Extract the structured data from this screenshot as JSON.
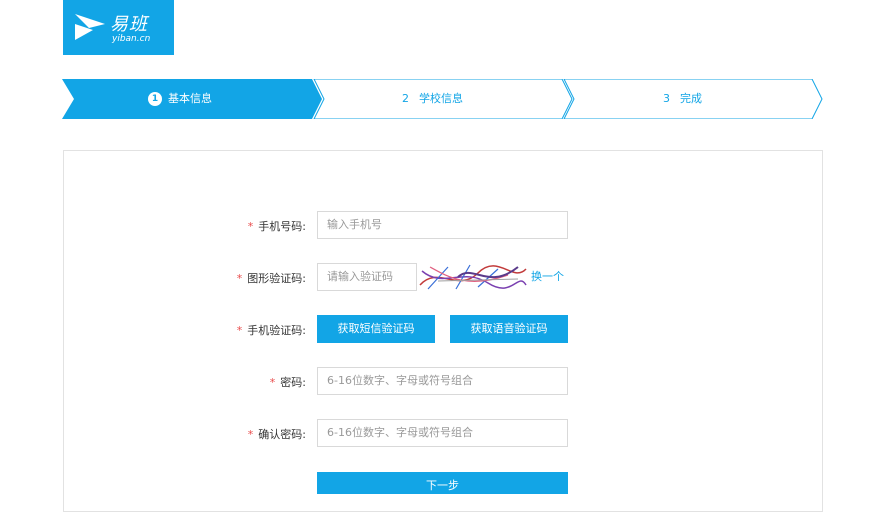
{
  "logo": {
    "name": "易班",
    "domain": "yiban.cn"
  },
  "steps": [
    {
      "num": "1",
      "label": "基本信息"
    },
    {
      "num": "2",
      "label": "学校信息"
    },
    {
      "num": "3",
      "label": "完成"
    }
  ],
  "form": {
    "phone": {
      "label": "手机号码:",
      "placeholder": "输入手机号"
    },
    "captcha": {
      "label": "图形验证码:",
      "placeholder": "请输入验证码",
      "change": "换一个"
    },
    "sms": {
      "label": "手机验证码:",
      "sms_button": "获取短信验证码",
      "voice_button": "获取语音验证码"
    },
    "password": {
      "label": "密码:",
      "placeholder": "6-16位数字、字母或符号组合"
    },
    "confirm": {
      "label": "确认密码:",
      "placeholder": "6-16位数字、字母或符号组合"
    },
    "required_mark": "*",
    "next_button": "下一步"
  },
  "colors": {
    "accent": "#12a5e6",
    "required": "#e94b4b"
  }
}
